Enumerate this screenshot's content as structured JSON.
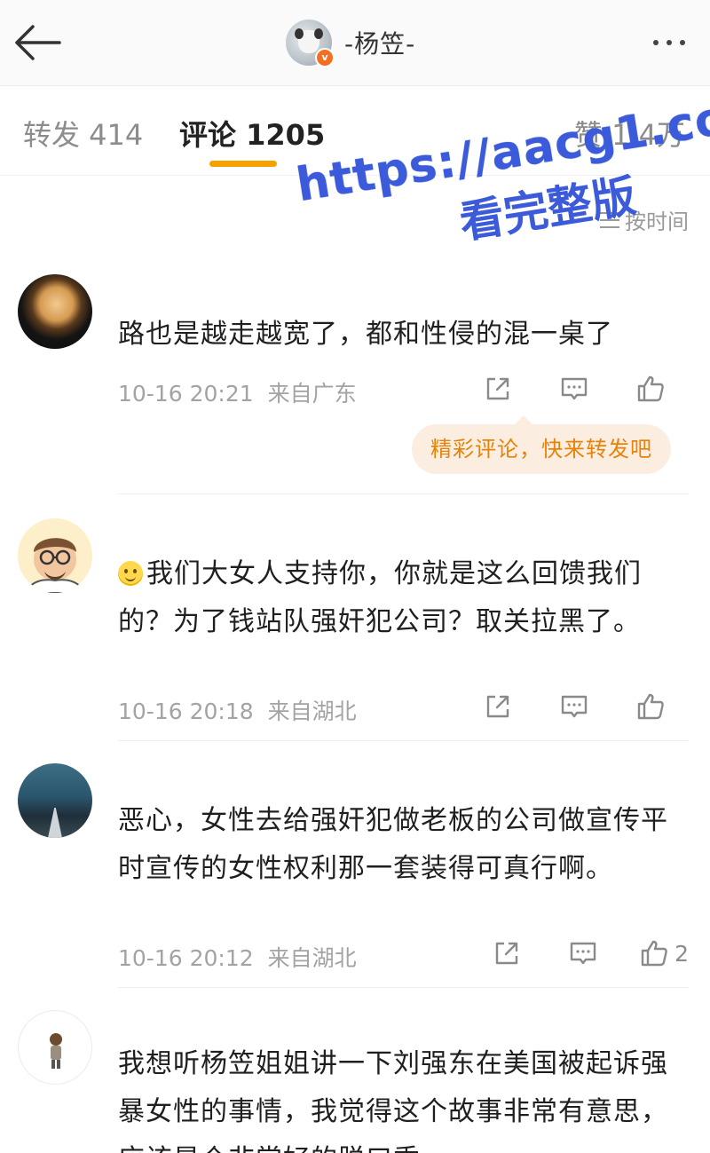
{
  "header": {
    "user_name": "-杨笠-",
    "verified_badge": "v"
  },
  "tabs": [
    {
      "label": "转发 414"
    },
    {
      "label": "评论 1205"
    },
    {
      "label": "赞 1.4万"
    }
  ],
  "sort": {
    "label": "按时间"
  },
  "watermark": {
    "line1": "https://aacg1.com",
    "line2": "看完整版"
  },
  "colors": {
    "accent": "#f5a100",
    "watermark": "#3b5bdb",
    "hot_bubble_text": "#e7820a"
  },
  "comments": [
    {
      "text": "路也是越走越宽了，都和性侵的混一桌了",
      "time": "10-16 20:21",
      "location": "来自广东",
      "like_count": "",
      "hot_hint": "精彩评论，快来转发吧"
    },
    {
      "emoji": "smile-emoji",
      "text": "我们大女人支持你，你就是这么回馈我们的？为了钱站队强奸犯公司？取关拉黑了。",
      "time": "10-16 20:18",
      "location": "来自湖北",
      "like_count": ""
    },
    {
      "text": "恶心，女性去给强奸犯做老板的公司做宣传平时宣传的女性权利那一套装得可真行啊。",
      "time": "10-16 20:12",
      "location": "来自湖北",
      "like_count": "2"
    },
    {
      "text": "我想听杨笠姐姐讲一下刘强东在美国被起诉强暴女性的事情，我觉得这个故事非常有意思，应该是个非常好的脱口秀",
      "time": "",
      "location": "",
      "like_count": ""
    }
  ]
}
